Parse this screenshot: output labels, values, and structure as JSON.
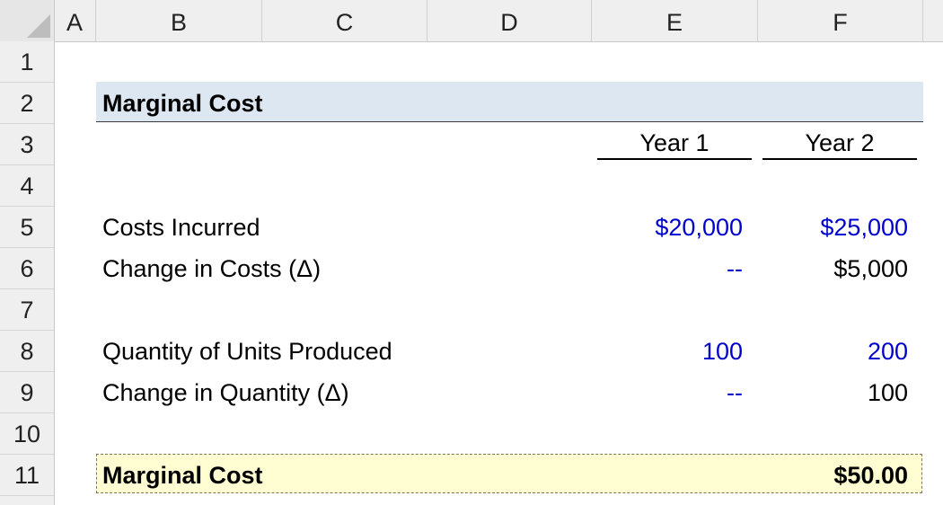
{
  "columns": [
    "A",
    "B",
    "C",
    "D",
    "E",
    "F"
  ],
  "rows": [
    "1",
    "2",
    "3",
    "4",
    "5",
    "6",
    "7",
    "8",
    "9",
    "10",
    "11"
  ],
  "table": {
    "title": "Marginal Cost",
    "headers": {
      "year1": "Year 1",
      "year2": "Year 2"
    },
    "costs_incurred": {
      "label": "Costs Incurred",
      "year1": "$20,000",
      "year2": "$25,000"
    },
    "change_costs": {
      "label": "Change in Costs (Δ)",
      "year1": "--",
      "year2": "$5,000"
    },
    "quantity": {
      "label": "Quantity of Units Produced",
      "year1": "100",
      "year2": "200"
    },
    "change_quantity": {
      "label": "Change in Quantity (Δ)",
      "year1": "--",
      "year2": "100"
    },
    "result": {
      "label": "Marginal Cost",
      "value": "$50.00"
    }
  },
  "colors": {
    "input_blue": "#0000cc",
    "title_fill": "#dde7f1",
    "result_fill": "#fffdd1"
  }
}
